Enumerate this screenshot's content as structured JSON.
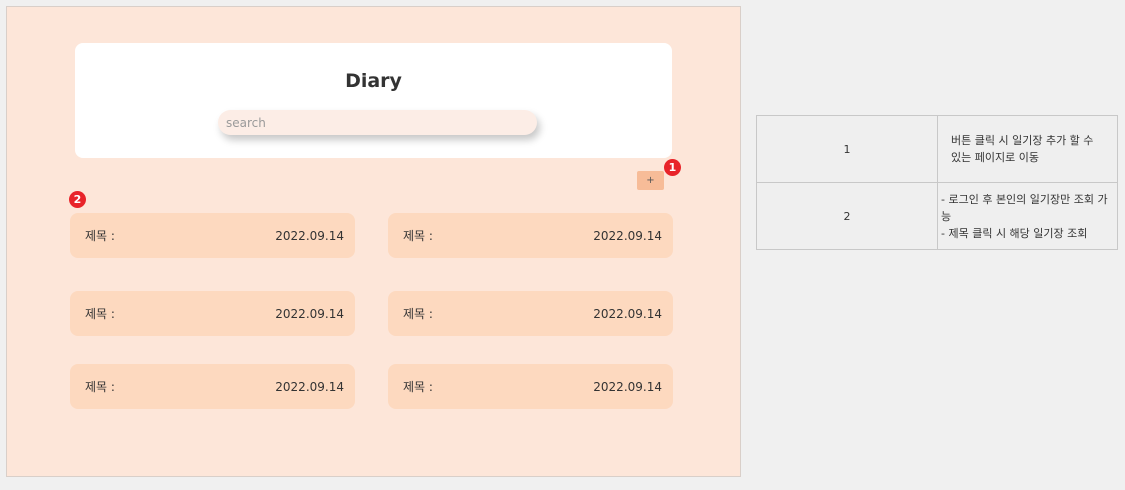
{
  "app": {
    "title": "Diary"
  },
  "search": {
    "placeholder": "search"
  },
  "toolbar": {
    "add_label": "+"
  },
  "markers": [
    "1",
    "2"
  ],
  "diary_list": [
    {
      "title_label": "제목 :",
      "date": "2022.09.14"
    },
    {
      "title_label": "제목 :",
      "date": "2022.09.14"
    },
    {
      "title_label": "제목 :",
      "date": "2022.09.14"
    },
    {
      "title_label": "제목 :",
      "date": "2022.09.14"
    },
    {
      "title_label": "제목 :",
      "date": "2022.09.14"
    },
    {
      "title_label": "제목 :",
      "date": "2022.09.14"
    }
  ],
  "spec_table": {
    "rows": [
      {
        "number": "1",
        "description": [
          "버튼 클릭 시 일기장 추가 할 수 있는 페이지로 이동"
        ]
      },
      {
        "number": "2",
        "description": [
          "- 로그인 후 본인의 일기장만 조회 가능",
          "- 제목 클릭 시 해당 일기장 조회"
        ]
      }
    ]
  },
  "colors": {
    "background": "#fde6d9",
    "card": "#fdd9bf",
    "add_button": "#f7bc98",
    "marker": "#e8242a"
  }
}
